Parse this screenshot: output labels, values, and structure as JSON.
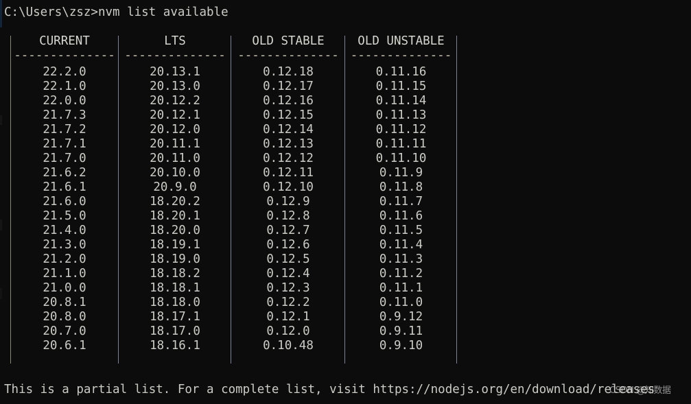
{
  "terminal": {
    "prompt_line": "C:\\Users\\zsz>nvm list available",
    "footer": "This is a partial list. For a complete list, visit https://nodejs.org/en/download/releases",
    "watermark": "CSDN @知数据",
    "background_color": "#0c0c0c",
    "text_color": "#ccccc7",
    "rule_color": "#7f8396"
  },
  "table": {
    "headers": [
      "CURRENT",
      "LTS",
      "OLD STABLE",
      "OLD UNSTABLE"
    ],
    "separators": [
      "--------------",
      "--------------",
      "--------------",
      "--------------"
    ],
    "rows": [
      [
        "22.2.0",
        "20.13.1",
        "0.12.18",
        "0.11.16"
      ],
      [
        "22.1.0",
        "20.13.0",
        "0.12.17",
        "0.11.15"
      ],
      [
        "22.0.0",
        "20.12.2",
        "0.12.16",
        "0.11.14"
      ],
      [
        "21.7.3",
        "20.12.1",
        "0.12.15",
        "0.11.13"
      ],
      [
        "21.7.2",
        "20.12.0",
        "0.12.14",
        "0.11.12"
      ],
      [
        "21.7.1",
        "20.11.1",
        "0.12.13",
        "0.11.11"
      ],
      [
        "21.7.0",
        "20.11.0",
        "0.12.12",
        "0.11.10"
      ],
      [
        "21.6.2",
        "20.10.0",
        "0.12.11",
        "0.11.9"
      ],
      [
        "21.6.1",
        "20.9.0",
        "0.12.10",
        "0.11.8"
      ],
      [
        "21.6.0",
        "18.20.2",
        "0.12.9",
        "0.11.7"
      ],
      [
        "21.5.0",
        "18.20.1",
        "0.12.8",
        "0.11.6"
      ],
      [
        "21.4.0",
        "18.20.0",
        "0.12.7",
        "0.11.5"
      ],
      [
        "21.3.0",
        "18.19.1",
        "0.12.6",
        "0.11.4"
      ],
      [
        "21.2.0",
        "18.19.0",
        "0.12.5",
        "0.11.3"
      ],
      [
        "21.1.0",
        "18.18.2",
        "0.12.4",
        "0.11.2"
      ],
      [
        "21.0.0",
        "18.18.1",
        "0.12.3",
        "0.11.1"
      ],
      [
        "20.8.1",
        "18.18.0",
        "0.12.2",
        "0.11.0"
      ],
      [
        "20.8.0",
        "18.17.1",
        "0.12.1",
        "0.9.12"
      ],
      [
        "20.7.0",
        "18.17.0",
        "0.12.0",
        "0.9.11"
      ],
      [
        "20.6.1",
        "18.16.1",
        "0.10.48",
        "0.9.10"
      ]
    ]
  }
}
